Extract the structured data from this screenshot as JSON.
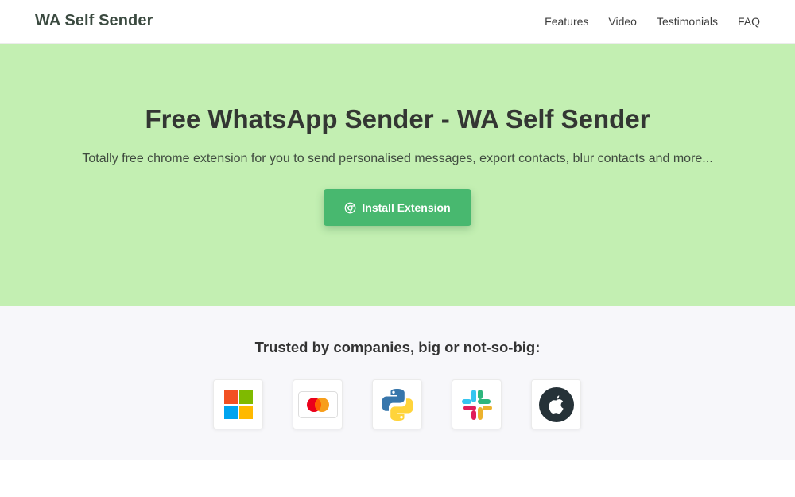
{
  "brand": {
    "name": "WA Self Sender"
  },
  "nav": {
    "items": [
      {
        "label": "Features"
      },
      {
        "label": "Video"
      },
      {
        "label": "Testimonials"
      },
      {
        "label": "FAQ"
      }
    ]
  },
  "hero": {
    "title": "Free WhatsApp Sender - WA Self Sender",
    "subtitle": "Totally free chrome extension for you to send personalised messages, export contacts, blur contacts and more...",
    "cta": {
      "label": "Install Extension",
      "icon": "chrome-icon"
    }
  },
  "trusted": {
    "title": "Trusted by companies, big or not-so-big:",
    "logos": [
      {
        "icon": "microsoft-logo-icon"
      },
      {
        "icon": "mastercard-logo-icon"
      },
      {
        "icon": "python-logo-icon"
      },
      {
        "icon": "slack-logo-icon"
      },
      {
        "icon": "apple-logo-icon"
      }
    ]
  },
  "colors": {
    "hero_background": "#c3efb2",
    "button_green": "#48b86f",
    "trusted_background": "#f7f7fa",
    "brand_text": "#3b4a40"
  }
}
